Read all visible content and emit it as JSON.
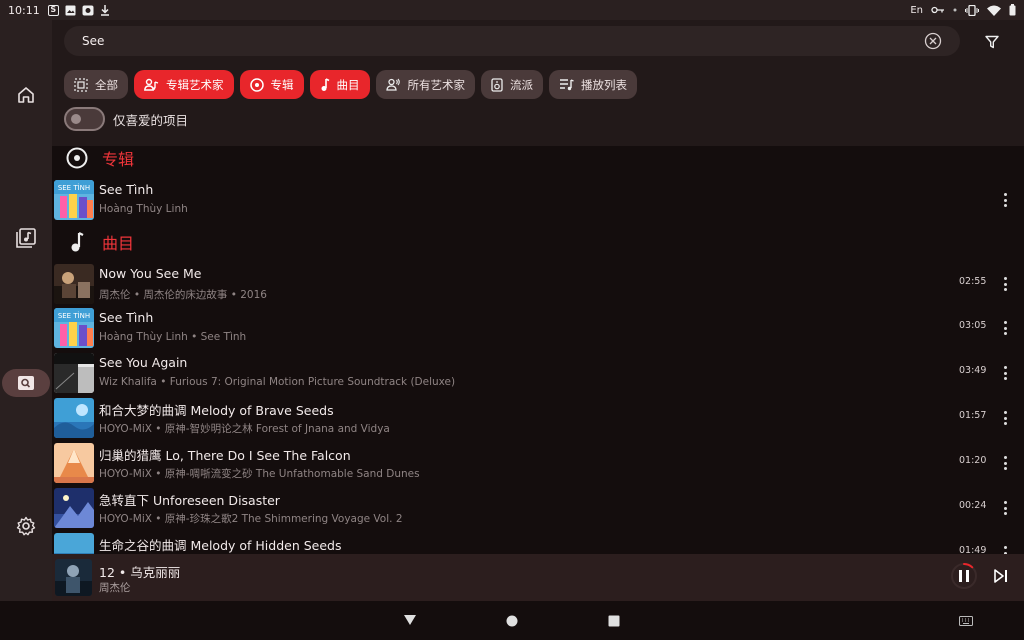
{
  "status_bar": {
    "time": "10:11",
    "left_icons": [
      "s-icon",
      "image-icon",
      "app-icon",
      "download-icon"
    ],
    "lang": "En",
    "right_icons": [
      "key-icon",
      "dot-icon",
      "vibrate-icon",
      "wifi-icon",
      "battery-icon"
    ]
  },
  "nav": {
    "items": [
      "home-icon",
      "library-icon",
      "search-icon",
      "settings-icon"
    ],
    "active": "search"
  },
  "search": {
    "query": "See"
  },
  "chips": [
    {
      "label": "全部",
      "icon": "all-icon",
      "selected": false
    },
    {
      "label": "专辑艺术家",
      "icon": "album-artist-icon",
      "selected": true
    },
    {
      "label": "专辑",
      "icon": "album-icon",
      "selected": true
    },
    {
      "label": "曲目",
      "icon": "music-note-icon",
      "selected": true
    },
    {
      "label": "所有艺术家",
      "icon": "artist-icon",
      "selected": false
    },
    {
      "label": "流派",
      "icon": "genre-icon",
      "selected": false
    },
    {
      "label": "播放列表",
      "icon": "playlist-icon",
      "selected": false
    }
  ],
  "favorites_toggle": {
    "label": "仅喜爱的项目",
    "on": false
  },
  "sections": {
    "albums": {
      "title": "专辑",
      "items": [
        {
          "title": "See Tình",
          "subtitle": "Hoàng Thùy Linh"
        }
      ]
    },
    "tracks": {
      "title": "曲目",
      "items": [
        {
          "title": "Now You See Me",
          "subtitle": "周杰伦 • 周杰伦的床边故事 • 2016",
          "duration": "02:55"
        },
        {
          "title": "See Tình",
          "subtitle": "Hoàng Thùy Linh • See Tình",
          "duration": "03:05"
        },
        {
          "title": "See You Again",
          "subtitle": "Wiz Khalifa • Furious 7: Original Motion Picture Soundtrack (Deluxe)",
          "duration": "03:49"
        },
        {
          "title": "和合大梦的曲调 Melody of Brave Seeds",
          "subtitle": "HOYO-MiX • 原神-智妙明论之林 Forest of Jnana and Vidya",
          "duration": "01:57"
        },
        {
          "title": "归巢的猎鹰 Lo, There Do I See The Falcon",
          "subtitle": "HOYO-MiX • 原神-啁哳流变之砂 The Unfathomable Sand Dunes",
          "duration": "01:20"
        },
        {
          "title": "急转直下 Unforeseen Disaster",
          "subtitle": "HOYO-MiX • 原神-珍珠之歌2 The Shimmering Voyage Vol. 2",
          "duration": "00:24"
        },
        {
          "title": "生命之谷的曲调 Melody of Hidden Seeds",
          "subtitle": "",
          "duration": "01:49"
        }
      ]
    }
  },
  "now_playing": {
    "title": "12 • 乌克丽丽",
    "artist": "周杰伦",
    "progress": 0.12
  },
  "colors": {
    "accent": "#e8262b",
    "background": "#140d0d",
    "rail": "#2a2020",
    "chip": "#4a3a3a"
  }
}
